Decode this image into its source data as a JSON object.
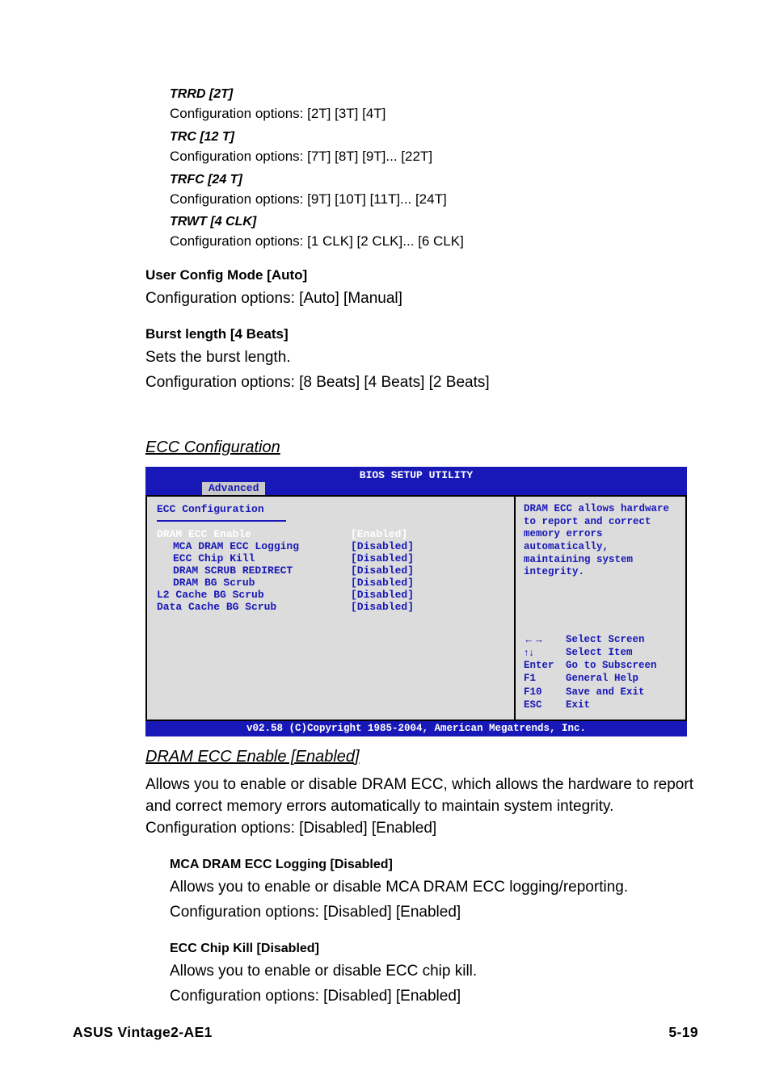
{
  "params": {
    "trrd": {
      "name": "TRRD [2T]",
      "opts": "Configuration options: [2T] [3T] [4T]"
    },
    "trc": {
      "name": "TRC [12 T]",
      "opts": "Configuration options: [7T] [8T] [9T]... [22T]"
    },
    "trfc": {
      "name": "TRFC [24 T]",
      "opts": "Configuration options: [9T] [10T] [11T]... [24T]"
    },
    "trwt": {
      "name": "TRWT [4 CLK]",
      "opts": "Configuration options: [1 CLK] [2 CLK]... [6 CLK]"
    }
  },
  "user_config": {
    "heading": "User Config Mode [Auto]",
    "body": "Configuration options: [Auto] [Manual]"
  },
  "burst": {
    "heading": "Burst length [4 Beats]",
    "body1": "Sets the burst length.",
    "body2": "Configuration options: [8 Beats] [4 Beats] [2 Beats]"
  },
  "ecc_section_title": "ECC Configuration",
  "bios": {
    "title": "BIOS SETUP UTILITY",
    "active_tab": "Advanced",
    "left_title": "ECC Configuration",
    "items": [
      {
        "label": "DRAM ECC Enable",
        "value": "[Enabled]",
        "indent": false,
        "selected": true
      },
      {
        "label": "MCA DRAM ECC Logging",
        "value": "[Disabled]",
        "indent": true,
        "selected": false
      },
      {
        "label": "ECC Chip Kill",
        "value": "[Disabled]",
        "indent": true,
        "selected": false
      },
      {
        "label": "DRAM SCRUB REDIRECT",
        "value": "[Disabled]",
        "indent": true,
        "selected": false
      },
      {
        "label": "DRAM BG Scrub",
        "value": "[Disabled]",
        "indent": true,
        "selected": false
      },
      {
        "label": "L2 Cache BG Scrub",
        "value": "[Disabled]",
        "indent": false,
        "selected": false
      },
      {
        "label": "Data Cache BG Scrub",
        "value": "[Disabled]",
        "indent": false,
        "selected": false
      }
    ],
    "help_text": "DRAM ECC allows hardware to report and correct memory errors automatically, maintaining system integrity.",
    "nav": [
      {
        "key": "←→",
        "label": "Select Screen"
      },
      {
        "key": "↑↓",
        "label": "Select Item"
      },
      {
        "key": "Enter",
        "label": "Go to Subscreen"
      },
      {
        "key": "F1",
        "label": "General Help"
      },
      {
        "key": "F10",
        "label": "Save and Exit"
      },
      {
        "key": "ESC",
        "label": "Exit"
      }
    ],
    "footer": "v02.58 (C)Copyright 1985-2004, American Megatrends, Inc."
  },
  "dram_ecc": {
    "heading": "DRAM ECC Enable [Enabled]",
    "body": "Allows you to enable or disable DRAM ECC, which allows the hardware to report and correct memory errors automatically to maintain system integrity. Configuration options: [Disabled] [Enabled]"
  },
  "mca": {
    "heading": "MCA DRAM ECC Logging [Disabled]",
    "body1": "Allows you to enable or disable MCA DRAM ECC logging/reporting.",
    "body2": "Configuration options: [Disabled] [Enabled]"
  },
  "chipkill": {
    "heading": "ECC Chip Kill  [Disabled]",
    "body1": "Allows you to enable or disable ECC chip kill.",
    "body2": "Configuration options: [Disabled] [Enabled]"
  },
  "footer": {
    "left": "ASUS Vintage2-AE1",
    "right": "5-19"
  }
}
